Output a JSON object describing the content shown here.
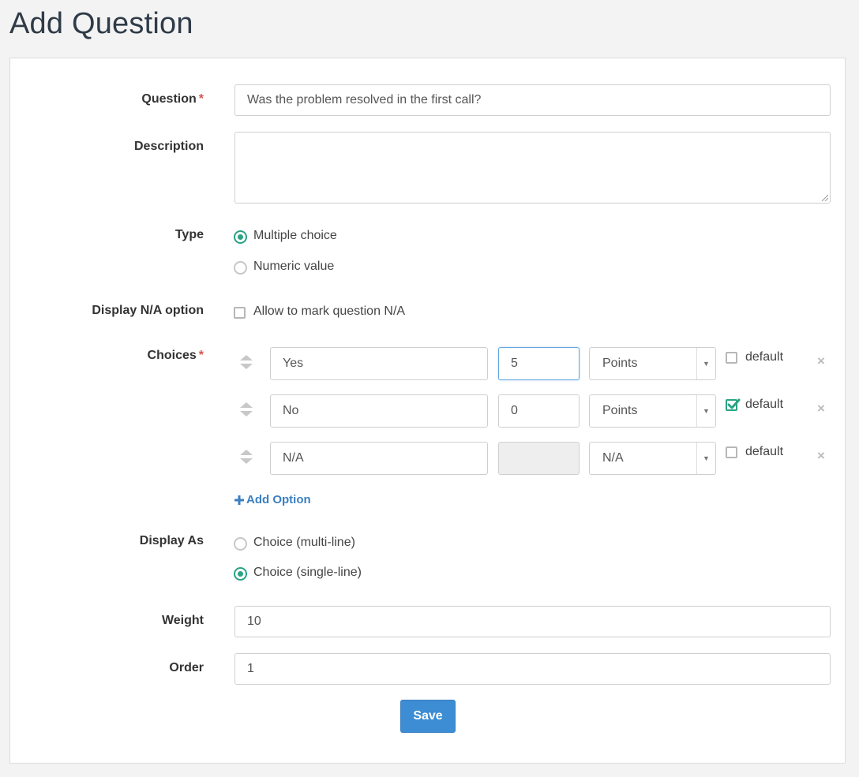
{
  "page": {
    "title": "Add Question"
  },
  "form": {
    "question": {
      "label": "Question",
      "required_mark": "*",
      "value": "Was the problem resolved in the first call?"
    },
    "description": {
      "label": "Description",
      "value": ""
    },
    "type": {
      "label": "Type",
      "options": [
        {
          "label": "Multiple choice",
          "selected": true
        },
        {
          "label": "Numeric value",
          "selected": false
        }
      ]
    },
    "na_option": {
      "label": "Display N/A option",
      "checkbox_label": "Allow to mark question N/A",
      "checked": false
    },
    "choices": {
      "label": "Choices",
      "required_mark": "*",
      "items": [
        {
          "text": "Yes",
          "value": "5",
          "unit": "Points",
          "default_label": "default",
          "default": false
        },
        {
          "text": "No",
          "value": "0",
          "unit": "Points",
          "default_label": "default",
          "default": true
        },
        {
          "text": "N/A",
          "value": "",
          "unit": "N/A",
          "default_label": "default",
          "default": false
        }
      ],
      "add_option_label": "Add Option",
      "remove_glyph": "×",
      "caret_glyph": "▼"
    },
    "display_as": {
      "label": "Display As",
      "options": [
        {
          "label": "Choice (multi-line)",
          "selected": false
        },
        {
          "label": "Choice (single-line)",
          "selected": true
        }
      ]
    },
    "weight": {
      "label": "Weight",
      "value": "10"
    },
    "order": {
      "label": "Order",
      "value": "1"
    },
    "save_label": "Save"
  },
  "colors": {
    "accent_green": "#2aa384",
    "link_blue": "#3a7fc1",
    "button_blue": "#3c8dd3",
    "required_red": "#d9534f"
  }
}
